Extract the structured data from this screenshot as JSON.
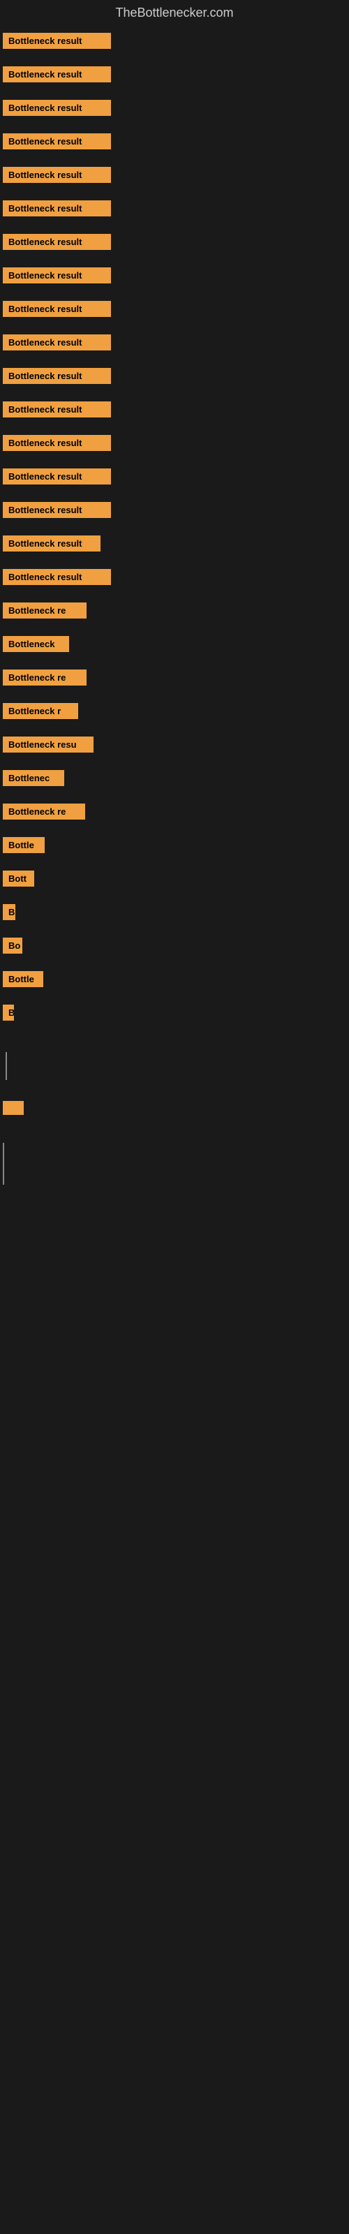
{
  "site": {
    "title": "TheBottlenecker.com"
  },
  "bars": [
    {
      "label": "Bottleneck result",
      "width": 155
    },
    {
      "label": "Bottleneck result",
      "width": 155
    },
    {
      "label": "Bottleneck result",
      "width": 155
    },
    {
      "label": "Bottleneck result",
      "width": 155
    },
    {
      "label": "Bottleneck result",
      "width": 155
    },
    {
      "label": "Bottleneck result",
      "width": 155
    },
    {
      "label": "Bottleneck result",
      "width": 155
    },
    {
      "label": "Bottleneck result",
      "width": 155
    },
    {
      "label": "Bottleneck result",
      "width": 155
    },
    {
      "label": "Bottleneck result",
      "width": 155
    },
    {
      "label": "Bottleneck result",
      "width": 155
    },
    {
      "label": "Bottleneck result",
      "width": 155
    },
    {
      "label": "Bottleneck result",
      "width": 155
    },
    {
      "label": "Bottleneck result",
      "width": 155
    },
    {
      "label": "Bottleneck result",
      "width": 155
    },
    {
      "label": "Bottleneck result",
      "width": 140
    },
    {
      "label": "Bottleneck result",
      "width": 155
    },
    {
      "label": "Bottleneck re",
      "width": 120
    },
    {
      "label": "Bottleneck",
      "width": 95
    },
    {
      "label": "Bottleneck re",
      "width": 120
    },
    {
      "label": "Bottleneck r",
      "width": 108
    },
    {
      "label": "Bottleneck resu",
      "width": 130
    },
    {
      "label": "Bottlenec",
      "width": 88
    },
    {
      "label": "Bottleneck re",
      "width": 118
    },
    {
      "label": "Bottle",
      "width": 60
    },
    {
      "label": "Bott",
      "width": 45
    },
    {
      "label": "B",
      "width": 18
    },
    {
      "label": "Bo",
      "width": 28
    },
    {
      "label": "Bottle",
      "width": 58
    },
    {
      "label": "B",
      "width": 16
    }
  ]
}
